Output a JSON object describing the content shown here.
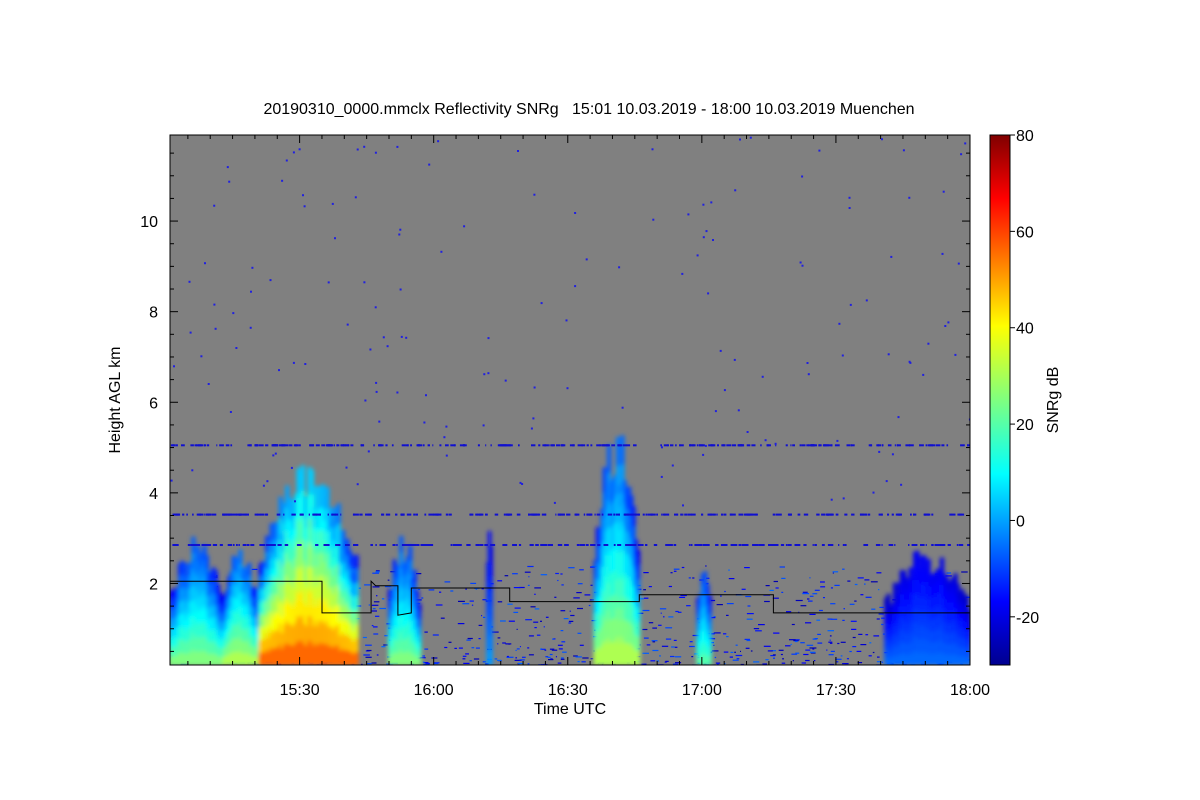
{
  "chart_data": {
    "type": "heatmap",
    "title": "20190310_0000.mmclx Reflectivity SNRg   15:01 10.03.2019 - 18:00 10.03.2019 Muenchen",
    "xlabel": "Time UTC",
    "ylabel": "Height AGL km",
    "x_ticks": [
      "15:30",
      "16:00",
      "16:30",
      "17:00",
      "17:30",
      "18:00"
    ],
    "y_ticks": [
      "2",
      "4",
      "6",
      "8",
      "10"
    ],
    "xlim": [
      "15:01",
      "18:00"
    ],
    "ylim": [
      0.2,
      11.9
    ],
    "background_color": "#808080",
    "colorbar": {
      "label": "SNRg dB",
      "range": [
        -30,
        80
      ],
      "ticks": [
        "-20",
        "0",
        "20",
        "40",
        "60",
        "80"
      ],
      "colormap": "jet"
    },
    "echo_regions": [
      {
        "time_start": "15:01",
        "time_end": "15:13",
        "top_km": 2.7,
        "peak_snr_db": 25
      },
      {
        "time_start": "15:13",
        "time_end": "15:21",
        "top_km": 2.6,
        "peak_snr_db": 30
      },
      {
        "time_start": "15:21",
        "time_end": "15:43",
        "top_km": 4.1,
        "peak_snr_db": 55
      },
      {
        "time_start": "15:50",
        "time_end": "15:57",
        "top_km": 2.8,
        "peak_snr_db": 25
      },
      {
        "time_start": "16:12",
        "time_end": "16:13",
        "top_km": 3.2,
        "peak_snr_db": 0
      },
      {
        "time_start": "16:36",
        "time_end": "16:46",
        "top_km": 4.8,
        "peak_snr_db": 30
      },
      {
        "time_start": "16:59",
        "time_end": "17:02",
        "top_km": 2.3,
        "peak_snr_db": 20
      },
      {
        "time_start": "17:41",
        "time_end": "18:00",
        "top_km": 2.5,
        "peak_snr_db": -5
      }
    ],
    "noise_bands_km": [
      5.05,
      3.52,
      2.85
    ],
    "boundary_line_km": [
      [
        "15:01",
        2.05
      ],
      [
        "15:35",
        2.05
      ],
      [
        "15:35",
        1.35
      ],
      [
        "15:46",
        1.35
      ],
      [
        "15:46",
        2.05
      ],
      [
        "15:47",
        1.95
      ],
      [
        "15:52",
        1.95
      ],
      [
        "15:52",
        1.3
      ],
      [
        "15:55",
        1.35
      ],
      [
        "15:55",
        1.9
      ],
      [
        "16:17",
        1.9
      ],
      [
        "16:17",
        1.6
      ],
      [
        "16:46",
        1.6
      ],
      [
        "16:46",
        1.75
      ],
      [
        "17:16",
        1.75
      ],
      [
        "17:16",
        1.35
      ],
      [
        "18:00",
        1.35
      ]
    ]
  }
}
